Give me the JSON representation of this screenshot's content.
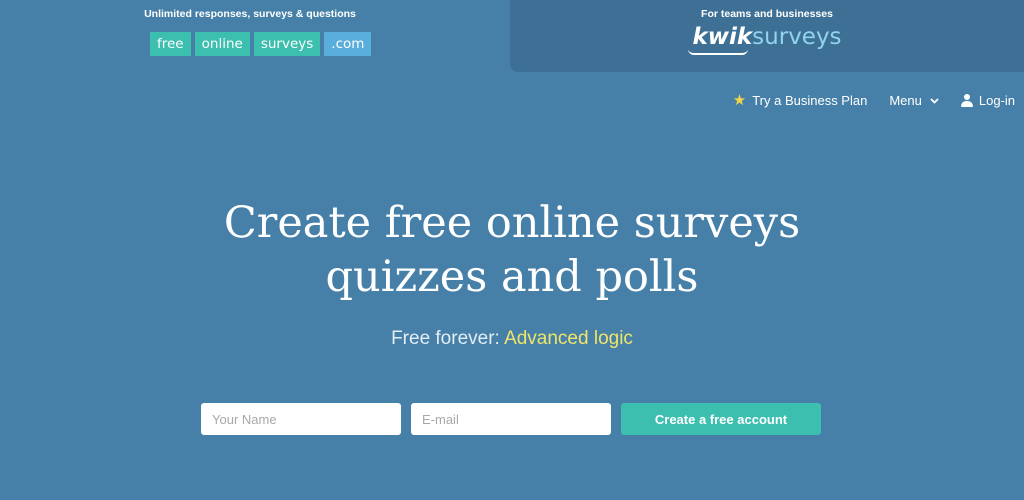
{
  "header": {
    "left_tagline": "Unlimited responses, surveys & questions",
    "left_logo": {
      "parts": [
        "free",
        "online",
        "surveys",
        ".com"
      ]
    },
    "right_tagline": "For teams and businesses",
    "right_logo": {
      "kwik": "kwik",
      "surveys": "surveys"
    }
  },
  "nav": {
    "business_plan": "Try a Business Plan",
    "menu": "Menu",
    "login": "Log-in"
  },
  "hero": {
    "title_line1": "Create free online surveys",
    "title_line2": "quizzes and polls",
    "subtitle_prefix": "Free forever: ",
    "subtitle_accent": "Advanced logic"
  },
  "signup": {
    "name_placeholder": "Your Name",
    "email_placeholder": "E-mail",
    "submit_label": "Create a free account"
  },
  "colors": {
    "background": "#4680a8",
    "top_right_panel": "#3e7096",
    "teal": "#3cbfae",
    "com_blue": "#5aaedb",
    "accent_yellow": "#f0e46a",
    "star": "#f0d44a"
  },
  "icons": {
    "star": "star-icon",
    "chevron": "chevron-down-icon",
    "user": "user-icon"
  }
}
